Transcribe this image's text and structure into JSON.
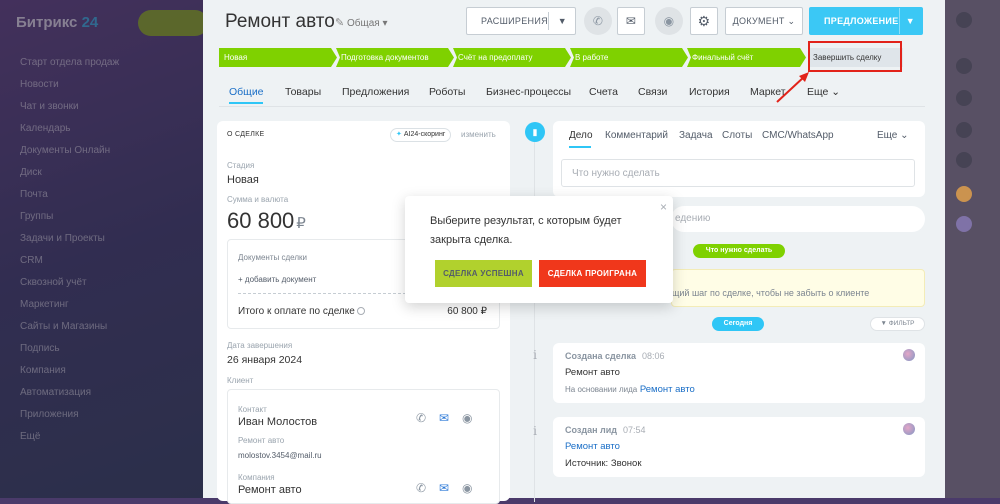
{
  "background": {
    "logo_main": "Битрикс",
    "logo_num": "24",
    "menu_items": [
      "Старт отдела продаж",
      "Новости",
      "Чат и звонки",
      "Календарь",
      "Документы Онлайн",
      "Диск",
      "Почта",
      "Группы",
      "Задачи и Проекты",
      "CRM",
      "Сквозной учёт",
      "Маркетинг",
      "Сайты и Магазины",
      "Подпись",
      "Компания",
      "Автоматизация",
      "Приложения",
      "Ещё"
    ]
  },
  "deal": {
    "title": "Ремонт авто",
    "category": "Общая"
  },
  "toolbar": {
    "extensions": "Расширения",
    "document": "Документ",
    "offer": "Предложение"
  },
  "stages": [
    {
      "label": "Новая"
    },
    {
      "label": "Подготовка документов"
    },
    {
      "label": "Счёт на предоплату"
    },
    {
      "label": "В работе"
    },
    {
      "label": "Финальный счёт"
    },
    {
      "label": "Завершить сделку"
    }
  ],
  "tabs": [
    "Общие",
    "Товары",
    "Предложения",
    "Роботы",
    "Бизнес-процессы",
    "Счета",
    "Связи",
    "История",
    "Маркет",
    "Еще"
  ],
  "about": {
    "header": "О СДЕЛКЕ",
    "ai_badge": "AI24-скоринг",
    "change": "изменить",
    "stage_label": "Стадия",
    "stage_value": "Новая",
    "amount_label": "Сумма и валюта",
    "amount_value": "60 800",
    "currency": "₽",
    "docs_label": "Документы сделки",
    "docs_add": "+ добавить документ",
    "total_label": "Итого к оплате по сделке",
    "total_value": "60 800 ₽",
    "close_label": "Дата завершения",
    "close_value": "26 января 2024",
    "client_label": "Клиент",
    "contact_label": "Контакт",
    "contact_name": "Иван Молостов",
    "contact_deal": "Ремонт авто",
    "contact_email": "molostov.3454@mail.ru",
    "company_label": "Компания",
    "company_name": "Ремонт авто"
  },
  "editor": {
    "tabs": [
      "Дело",
      "Комментарий",
      "Задача",
      "Слоты",
      "СМС/WhatsApp",
      "Еще"
    ],
    "placeholder": "Что нужно сделать",
    "search_partial": "едению"
  },
  "timeline": {
    "todo_pill": "Что нужно сделать",
    "yellow_text": "щий шаг по сделке, чтобы не забыть о клиенте",
    "today_pill": "Сегодня",
    "filter": "ФИЛЬТР",
    "events": [
      {
        "title": "Создана сделка",
        "time": "08:06",
        "line1": "Ремонт авто",
        "line2_prefix": "На основании лида",
        "line2_link": "Ремонт авто"
      },
      {
        "title": "Создан лид",
        "time": "07:54",
        "line1": "Ремонт авто",
        "line2": "Источник: Звонок"
      }
    ]
  },
  "popup": {
    "text": "Выберите результат, с которым будет закрыта сделка.",
    "success": "Сделка успешна",
    "fail": "Сделка проиграна"
  },
  "colors": {
    "accent": "#2fc6f6",
    "stage_green": "#7fd100",
    "highlight_red": "#e2231a",
    "fail_red": "#f0371b",
    "success_green": "#b1d12d"
  }
}
